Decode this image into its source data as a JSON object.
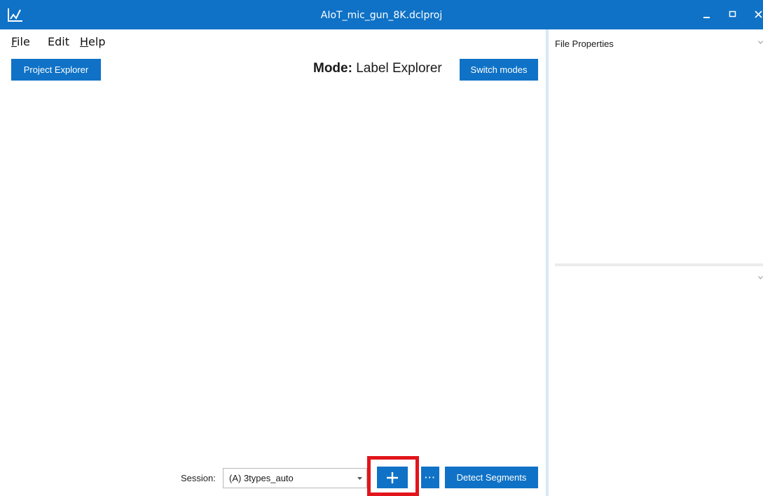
{
  "window": {
    "title": "AIoT_mic_gun_8K.dclproj",
    "icon": "chart-line-icon",
    "controls": [
      "minimize-icon",
      "maximize-icon",
      "close-icon"
    ]
  },
  "menu": {
    "file": {
      "accel": "F",
      "rest": "ile"
    },
    "edit": {
      "label": "Edit"
    },
    "help": {
      "accel": "H",
      "rest": "elp"
    }
  },
  "toolbar": {
    "project_explorer": "Project Explorer",
    "mode_prefix": "Mode:",
    "mode_value": "Label Explorer",
    "switch_modes": "Switch modes"
  },
  "right_panel": {
    "title": "File Properties"
  },
  "footer": {
    "session_label": "Session:",
    "session_value": "(A) 3types_auto",
    "add_label": "+",
    "more_label": "···",
    "detect_segments": "Detect Segments"
  },
  "colors": {
    "accent": "#0f72c6",
    "highlight": "#e2151c"
  }
}
